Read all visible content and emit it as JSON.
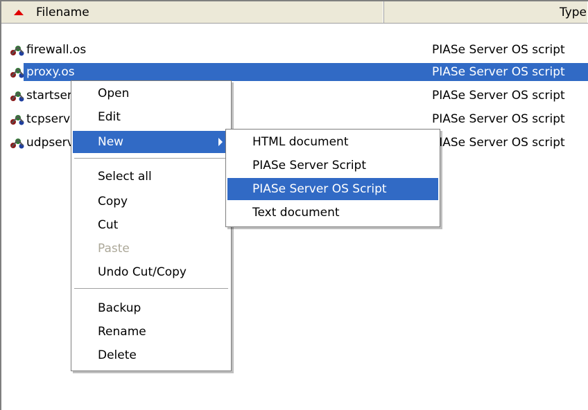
{
  "columns": {
    "filename": "Filename",
    "type": "Type"
  },
  "files": [
    {
      "name": "firewall.os",
      "type": "PIASe Server OS script",
      "selected": false
    },
    {
      "name": "proxy.os",
      "type": "PIASe Server OS script",
      "selected": true
    },
    {
      "name": "startserver.os",
      "type": "PIASe Server OS script",
      "selected": false
    },
    {
      "name": "tcpserver.os",
      "type": "PIASe Server OS script",
      "selected": false
    },
    {
      "name": "udpserver.os",
      "type": "PIASe Server OS script",
      "selected": false
    }
  ],
  "context_menu": {
    "open": "Open",
    "edit": "Edit",
    "new": "New",
    "select_all": "Select all",
    "copy": "Copy",
    "cut": "Cut",
    "paste": "Paste",
    "undo": "Undo Cut/Copy",
    "backup": "Backup",
    "rename": "Rename",
    "delete": "Delete"
  },
  "new_submenu": {
    "html": "HTML document",
    "script": "PIASe Server Script",
    "os_script": "PIASe Server OS Script",
    "text": "Text document"
  },
  "colors": {
    "selection": "#316ac5",
    "header_bg": "#ece9d8",
    "sort_arrow": "#e00000"
  },
  "icons": {
    "file": "script-file-icon",
    "sort": "sort-ascending-icon",
    "submenu": "submenu-arrow-icon"
  }
}
